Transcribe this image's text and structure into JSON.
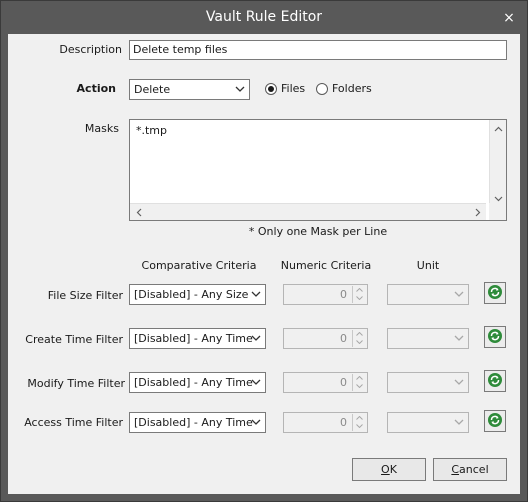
{
  "window": {
    "title": "Vault Rule Editor",
    "close_glyph": "×"
  },
  "description": {
    "label": "Description",
    "value": "Delete temp files"
  },
  "action": {
    "label": "Action",
    "value": "Delete",
    "options": [
      {
        "label": "Files",
        "selected": true
      },
      {
        "label": "Folders",
        "selected": false
      }
    ]
  },
  "masks": {
    "label": "Masks",
    "value": "*.tmp",
    "note": "* Only one Mask per Line"
  },
  "filters": {
    "headers": {
      "comparative": "Comparative Criteria",
      "numeric": "Numeric Criteria",
      "unit": "Unit"
    },
    "rows": [
      {
        "label": "File Size Filter",
        "criteria": "[Disabled] - Any Size",
        "number": "0",
        "unit": ""
      },
      {
        "label": "Create Time Filter",
        "criteria": "[Disabled] - Any Time",
        "number": "0",
        "unit": ""
      },
      {
        "label": "Modify Time Filter",
        "criteria": "[Disabled] - Any Time",
        "number": "0",
        "unit": ""
      },
      {
        "label": "Access Time Filter",
        "criteria": "[Disabled] - Any Time",
        "number": "0",
        "unit": ""
      }
    ]
  },
  "buttons": {
    "ok": {
      "label": "OK",
      "mnemonic": "O",
      "rest": "K"
    },
    "cancel": {
      "label": "Cancel",
      "mnemonic": "C",
      "rest": "ancel"
    }
  },
  "icons": {
    "close": "close-icon",
    "dropdown": "chevron-down-icon",
    "refresh": "refresh-icon",
    "spin_up": "spin-up-icon",
    "spin_down": "spin-down-icon"
  },
  "colors": {
    "titlebar": "#595959",
    "client": "#f0f0f0",
    "refresh_green": "#2e8b3a"
  }
}
